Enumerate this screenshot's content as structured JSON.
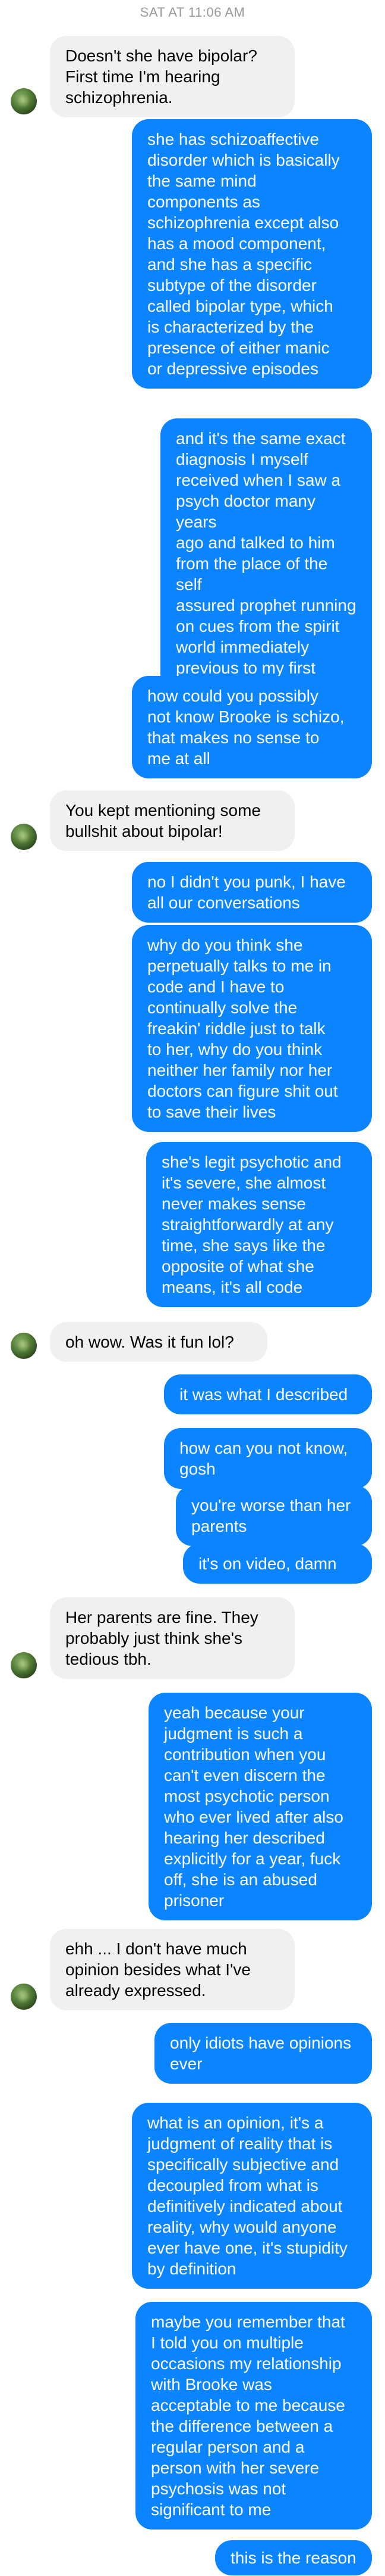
{
  "conversation": {
    "timestamp": "SAT AT 11:06 AM",
    "colors": {
      "outgoing_bubble": "#0a84ff",
      "incoming_bubble": "#f0f0f0",
      "timestamp_text": "#9a9a9a"
    },
    "avatar_icon": "contact-avatar-icon",
    "messages": [
      {
        "dir": "in",
        "text": "Doesn't she have bipolar?\nFirst time I'm hearing\nschizophrenia."
      },
      {
        "dir": "out",
        "text": "she has schizoaffective\ndisorder which is basically\nthe same mind\ncomponents as\nschizophrenia except also\nhas a mood component,\nand she has a specific\nsubtype of the disorder\ncalled bipolar type, which\nis characterized by the\npresence of either manic\nor depressive episodes"
      },
      {
        "dir": "out",
        "text": "and it's the same exact\ndiagnosis I myself\nreceived when I saw a\npsych doctor many years\nago and talked to him\nfrom the place of the self\nassured prophet running\non cues from the spirit\nworld immediately\nprevious to my first\nbelieving in Jesus"
      },
      {
        "dir": "out",
        "text": "how could you possibly\nnot know Brooke is schizo,\nthat makes no sense to\nme at all"
      },
      {
        "dir": "in",
        "text": "You kept mentioning some\nbullshit about bipolar!"
      },
      {
        "dir": "out",
        "text": "no I didn't you punk, I have\nall our conversations"
      },
      {
        "dir": "out",
        "text": "why do you think she\nperpetually talks to me in\ncode and I have to\ncontinually solve the\nfreakin' riddle just to talk\nto her, why do you think\nneither her family nor her\ndoctors can figure shit out\nto save their lives"
      },
      {
        "dir": "out",
        "text": "she's legit psychotic and\nit's severe, she almost\nnever makes sense\nstraightforwardly at any\ntime, she says like the\nopposite of what she\nmeans, it's all code"
      },
      {
        "dir": "in",
        "text": "oh wow. Was it fun lol?"
      },
      {
        "dir": "out",
        "text": "it was what I described"
      },
      {
        "dir": "out",
        "text": "how can you not know,\ngosh"
      },
      {
        "dir": "out",
        "text": "you're worse than her\nparents"
      },
      {
        "dir": "out",
        "text": "it's on video, damn"
      },
      {
        "dir": "in",
        "text": "Her parents are fine. They\nprobably just think she's\ntedious tbh."
      },
      {
        "dir": "out",
        "text": "yeah because your\njudgment is such a\ncontribution when you\ncan't even discern the\nmost psychotic person\nwho ever lived after also\nhearing her described\nexplicitly for a year, fuck\noff, she is an abused\nprisoner"
      },
      {
        "dir": "in",
        "text": "ehh ... I don't have much\nopinion besides what I've\nalready expressed."
      },
      {
        "dir": "out",
        "text": "only idiots have opinions\never"
      },
      {
        "dir": "out",
        "text": "what is an opinion, it's a\njudgment of reality that is\nspecifically subjective and\ndecoupled from what is\ndefinitively indicated about\nreality, why would anyone\never have one, it's stupidity\nby definition"
      },
      {
        "dir": "out",
        "text": "maybe you remember that\nI told you on multiple\noccasions my relationship\nwith Brooke was\nacceptable to me because\nthe difference between a\nregular person and a\nperson with her severe\npsychosis was not\nsignificant to me"
      },
      {
        "dir": "out",
        "text": "this is the reason"
      }
    ]
  }
}
